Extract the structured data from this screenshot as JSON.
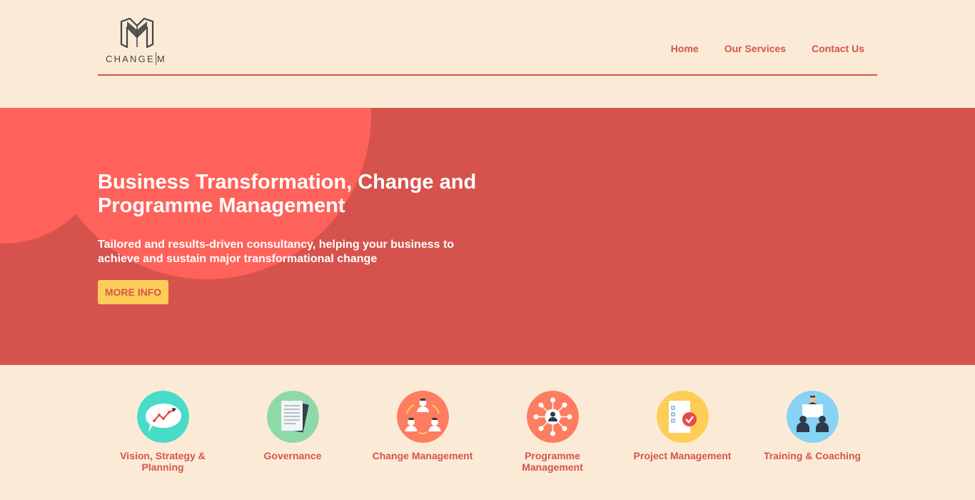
{
  "header": {
    "logo_text_left": "CHANGE",
    "logo_text_right": "M",
    "nav": [
      {
        "label": "Home"
      },
      {
        "label": "Our Services"
      },
      {
        "label": "Contact Us"
      }
    ]
  },
  "hero": {
    "title": "Business Transformation, Change and Programme Management",
    "subtitle": "Tailored and results-driven consultancy, helping your business to achieve and sustain major transformational change",
    "button_label": "MORE INFO"
  },
  "services": [
    {
      "label": "Vision, Strategy & Planning",
      "icon": "chart-speech-bubble-icon",
      "color": "#48dbc8"
    },
    {
      "label": "Governance",
      "icon": "document-icon",
      "color": "#8ed9a8"
    },
    {
      "label": "Change Management",
      "icon": "team-cycle-icon",
      "color": "#fd7d61"
    },
    {
      "label": "Programme Management",
      "icon": "network-person-icon",
      "color": "#fd7d61"
    },
    {
      "label": "Project Management",
      "icon": "checklist-icon",
      "color": "#fecd57"
    },
    {
      "label": "Training & Coaching",
      "icon": "presenter-audience-icon",
      "color": "#86d3f4"
    }
  ],
  "colors": {
    "accent": "#d6534d",
    "background": "#fbebd6",
    "button": "#fecd57",
    "hero_blob": "#ff625a"
  }
}
